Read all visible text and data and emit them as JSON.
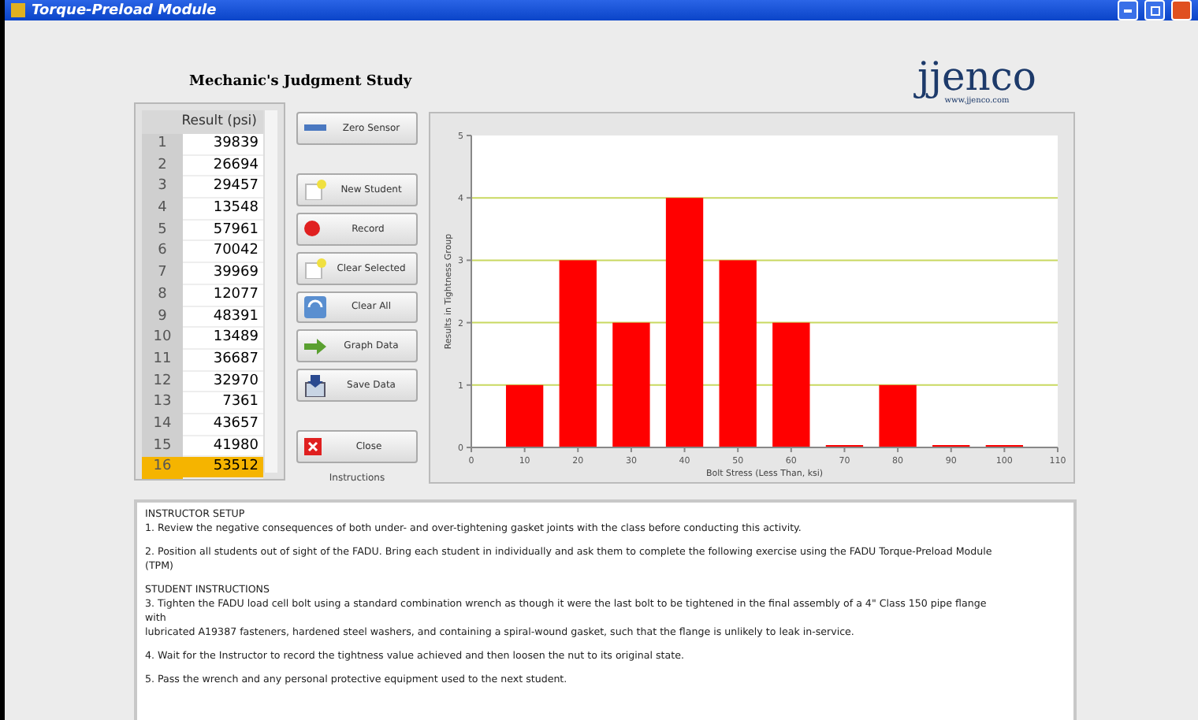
{
  "window": {
    "title": "Torque-Preload Module"
  },
  "heading": "Mechanic's Judgment Study",
  "logo": {
    "name": "jjenco",
    "url": "www.jjenco.com"
  },
  "table": {
    "column": "Result (psi)",
    "rows": [
      {
        "index": "1",
        "value": "39839",
        "selected": false
      },
      {
        "index": "2",
        "value": "26694",
        "selected": false
      },
      {
        "index": "3",
        "value": "29457",
        "selected": false
      },
      {
        "index": "4",
        "value": "13548",
        "selected": false
      },
      {
        "index": "5",
        "value": "57961",
        "selected": false
      },
      {
        "index": "6",
        "value": "70042",
        "selected": false
      },
      {
        "index": "7",
        "value": "39969",
        "selected": false
      },
      {
        "index": "8",
        "value": "12077",
        "selected": false
      },
      {
        "index": "9",
        "value": "48391",
        "selected": false
      },
      {
        "index": "10",
        "value": "13489",
        "selected": false
      },
      {
        "index": "11",
        "value": "36687",
        "selected": false
      },
      {
        "index": "12",
        "value": "32970",
        "selected": false
      },
      {
        "index": "13",
        "value": "7361",
        "selected": false
      },
      {
        "index": "14",
        "value": "43657",
        "selected": false
      },
      {
        "index": "15",
        "value": "41980",
        "selected": false
      },
      {
        "index": "16",
        "value": "53512",
        "selected": true
      }
    ]
  },
  "buttons": [
    {
      "label": "Zero Sensor",
      "kind": "dash",
      "gap": false
    },
    {
      "label": "New Student",
      "kind": "new",
      "gap": true
    },
    {
      "label": "Record",
      "kind": "record",
      "gap": false
    },
    {
      "label": "Clear Selected",
      "kind": "new",
      "gap": false
    },
    {
      "label": "Clear All",
      "kind": "refresh",
      "gap": false
    },
    {
      "label": "Graph Data",
      "kind": "graph",
      "gap": false
    },
    {
      "label": "Save Data",
      "kind": "save",
      "gap": false
    },
    {
      "label": "Close",
      "kind": "close",
      "gap": true
    }
  ],
  "chart": {
    "chart_data": {
      "type": "bar",
      "xlabel": "Bolt Stress (Less Than, ksi)",
      "ylabel": "Results in Tightness Group",
      "x": [
        10,
        20,
        30,
        40,
        50,
        60,
        70,
        80,
        90,
        100
      ],
      "series": [
        {
          "color": "#ff0000",
          "values": [
            1,
            3,
            2,
            4,
            3,
            2,
            0,
            1,
            0,
            0
          ]
        }
      ],
      "grid": true,
      "xlim": [
        0,
        110
      ],
      "ylim": [
        0,
        5
      ],
      "xticks": [
        0,
        10,
        20,
        30,
        40,
        50,
        60,
        70,
        80,
        90,
        100,
        110
      ],
      "yticks": [
        0,
        1,
        2,
        3,
        4,
        5
      ]
    }
  },
  "instructions": {
    "tab": "Instructions",
    "paragraphs": [
      [
        "INSTRUCTOR SETUP",
        "1.  Review the negative consequences of both under- and over-tightening gasket joints with the class before conducting this activity."
      ],
      [
        "2.  Position all students out of sight of the FADU. Bring each student in individually and ask them to complete the following exercise using the FADU Torque-Preload Module",
        "(TPM)"
      ],
      [
        "STUDENT INSTRUCTIONS",
        "3.  Tighten the FADU load cell bolt using a standard combination wrench as though it were the last bolt to be tightened in the final assembly of a 4\" Class 150 pipe flange",
        "with",
        "lubricated A19387 fasteners, hardened steel washers, and containing a spiral-wound gasket, such that the flange is unlikely to leak in-service."
      ],
      [
        "4.  Wait for the Instructor to record the tightness value achieved and then loosen the nut to its original state."
      ],
      [
        "5.  Pass the wrench and any personal protective equipment used to the next student."
      ]
    ]
  }
}
